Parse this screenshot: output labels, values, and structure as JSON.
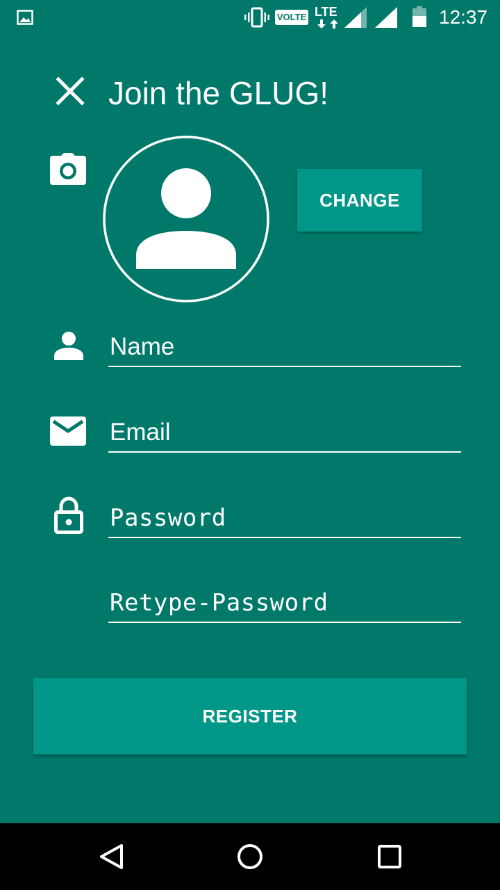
{
  "status_bar": {
    "network_badge": "VOLTE",
    "network_type": "LTE",
    "time": "12:37"
  },
  "header": {
    "title": "Join the GLUG!"
  },
  "avatar": {
    "change_label": "CHANGE"
  },
  "form": {
    "name_placeholder": "Name",
    "email_placeholder": "Email",
    "password_placeholder": "Password",
    "retype_password_placeholder": "Retype-Password",
    "register_label": "REGISTER"
  },
  "colors": {
    "background": "#00796B",
    "accent": "#009688",
    "text": "#FFFFFF",
    "nav_bar": "#000000"
  },
  "icons": {
    "status": [
      "gallery-icon",
      "vibrate-icon",
      "lte-icon",
      "signal-icon",
      "battery-icon"
    ],
    "form": [
      "close-icon",
      "camera-icon",
      "person-icon",
      "mail-icon",
      "lock-icon"
    ],
    "nav": [
      "back-icon",
      "home-icon",
      "recents-icon"
    ]
  }
}
